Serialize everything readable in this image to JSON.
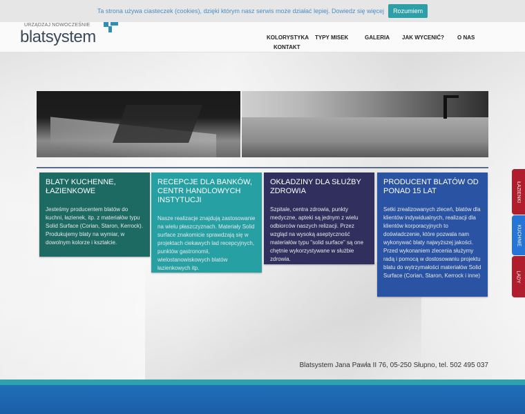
{
  "cookie": {
    "text": "Ta strona używa ciasteczek (cookies), dzięki którym nasz serwis może działać lepiej. Dowiedz się więcej",
    "button": "Rozumiem"
  },
  "logo": {
    "tagline": "URZĄDZAJ NOWOCZEŚNIE",
    "word": "blatsystem"
  },
  "nav": {
    "items": [
      "KOLORYSTYKA",
      "TYPY MISEK",
      "GALERIA",
      "JAK WYCENIĆ?",
      "O NAS",
      "KONTAKT"
    ]
  },
  "boxes": [
    {
      "title": "BLATY KUCHENNE, ŁAZIENKOWE",
      "text": "Jesteśmy producentem blatów do kuchni, łazienek, itp. z materiałów typu Solid Surface (Corian, Staron, Kerrock). Produkujemy blaty na wymiar, w dowolnym kolorze i kształcie."
    },
    {
      "title": "RECEPCJE DLA BANKÓW, CENTR HANDLOWYCH INSTYTUCJI",
      "text": "Nasze realizacje znajdują zastosowanie na wielu płaszczyznach. Materiały Solid surface znakomicie sprawdzają się w projektach ciekawych lad recepcyjnych, punktów gastronomii, wielostanowiskowych blatów łazienkowych itp."
    },
    {
      "title": "OKŁADZINY DLA SŁUŻBY ZDROWIA",
      "text": "Szpitale, centra zdrowia, punkty medyczne, apteki są jednym z wielu odbiorców naszych relizacji. Przez wzgląd na wysoką aseptyczność materiałów typu \"solid surface\" są one chętnie wykorzystywane w służbie zdrowia."
    },
    {
      "title": "PRODUCENT BLATÓW OD PONAD 15 LAT",
      "text": "Setki zrealizowanych zleceń, blatów dla klientów indywidualnych, realizacji dla klientów korporacyjnych to doświadczenie, które pozwala nam wykonywać blaty najwyższej jakości. Przed wykonaniem zlecenia służymy radą i pomocą w dostosowaniu projektu blatu do wytrzymałości materiałów Solid Surface (Corian, Staron, Kerrock i inne)"
    }
  ],
  "side_tabs": [
    "ŁAZIENKI",
    "KUCHNIE",
    "LADY"
  ],
  "footer": {
    "address": "Blatsystem Jana Pawła II 76, 05-250 Słupno, tel. 502 495 037"
  },
  "colors": {
    "accent": "#2d9fa6",
    "box1": "#1d6a63",
    "box2": "#26a0a3",
    "box3": "#302f5e",
    "box4": "#2a54a3",
    "side_red": "#b01d2d",
    "side_blue": "#2574d6"
  }
}
